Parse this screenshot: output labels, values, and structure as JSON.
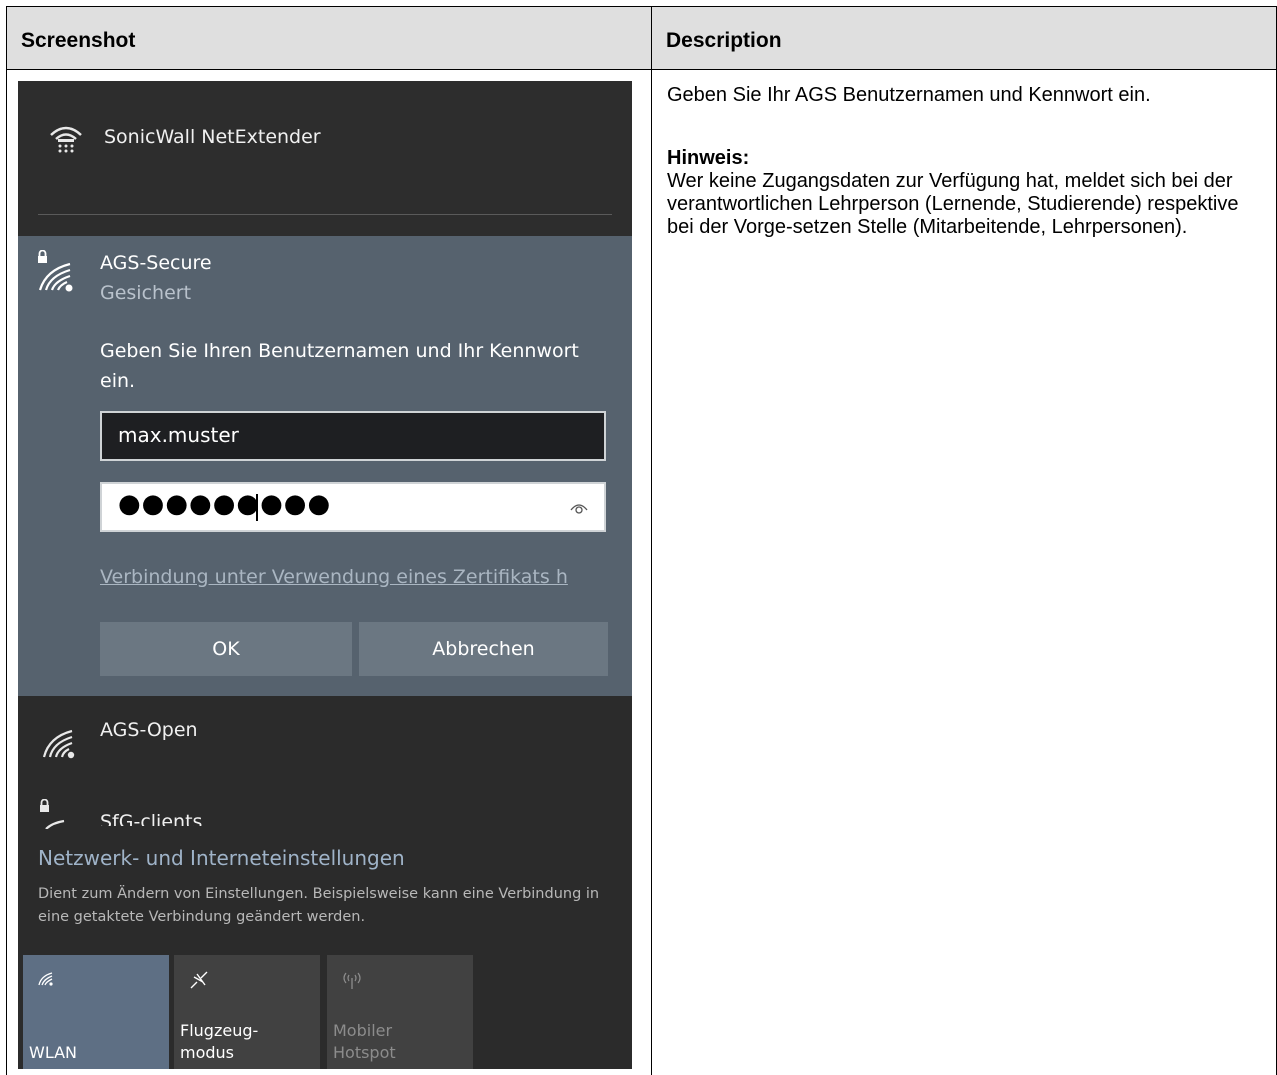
{
  "table": {
    "col_screenshot": "Screenshot",
    "col_description": "Description"
  },
  "description": {
    "intro": "Geben Sie Ihr AGS Benutzernamen und Kennwort ein.",
    "note_title": "Hinweis:",
    "note_text": "Wer keine Zugangsdaten zur Verfügung hat, meldet sich bei der verantwortlichen Lehrperson (Lernende, Studierende) respektive bei der Vorge-setzen Stelle (Mitarbeitende, Lehrpersonen)."
  },
  "flyout": {
    "vpn": {
      "name": "SonicWall NetExtender",
      "icon": "vpn-icon"
    },
    "secure_network": {
      "name": "AGS-Secure",
      "status": "Gesichert",
      "prompt": "Geben Sie Ihren Benutzernamen und Ihr Kennwort ein.",
      "username_value": "max.muster",
      "password_mask": "●●●●●●●●●",
      "cert_link": "Verbindung unter Verwendung eines Zertifikats h",
      "ok_label": "OK",
      "cancel_label": "Abbrechen"
    },
    "open_network": {
      "name": "AGS-Open"
    },
    "sfg_network": {
      "name": "SfG-clients"
    },
    "settings": {
      "title": "Netzwerk- und Interneteinstellungen",
      "description": "Dient zum Ändern von Einstellungen. Beispielsweise kann eine Verbindung in eine getaktete Verbindung geändert werden."
    },
    "tiles": {
      "wlan": "WLAN",
      "flugzeug": "Flugzeug-\nmodus",
      "hotspot": "Mobiler\nHotspot"
    },
    "colors": {
      "flyout_bg": "#2b2b2b",
      "selected_bg": "#56626e",
      "accent_link": "#9fb3c8",
      "wlan_tile": "#5e6f84"
    }
  }
}
